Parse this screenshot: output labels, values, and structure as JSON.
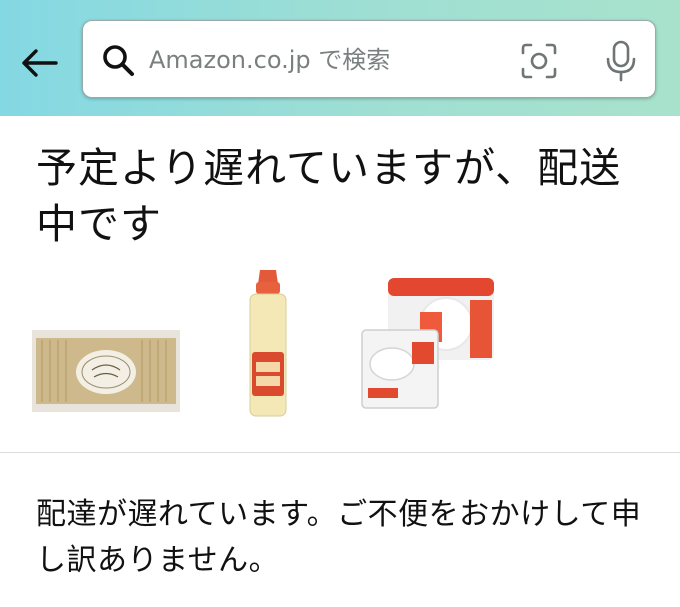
{
  "header": {
    "search_placeholder": "Amazon.co.jp で検索",
    "back_icon": "arrow-left-icon",
    "camera_icon": "camera-scan-icon",
    "mic_icon": "microphone-icon",
    "gradient_colors": [
      "#84d8e3",
      "#a8e2cc"
    ]
  },
  "status": {
    "headline": "予定より遅れていますが、配送中です"
  },
  "products": [
    {
      "name": "pasta-package"
    },
    {
      "name": "glue-bottle"
    },
    {
      "name": "rice-packs"
    }
  ],
  "message": {
    "text": "配達が遅れています。ご不便をおかけして申し訳ありません。"
  }
}
